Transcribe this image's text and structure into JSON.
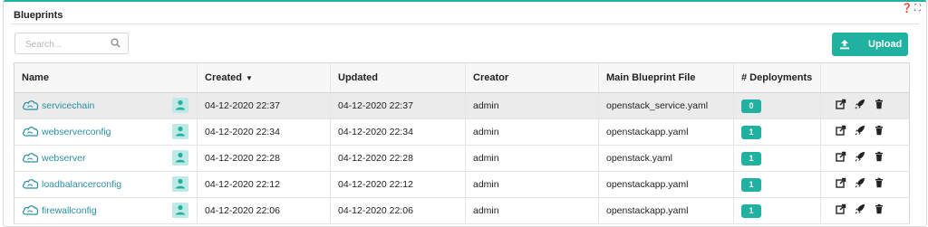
{
  "widget": {
    "title": "Blueprints",
    "help_icon": "help-icon",
    "expand_icon": "expand-icon"
  },
  "search": {
    "placeholder": "Search...",
    "icon": "search-icon"
  },
  "upload": {
    "label": "Upload",
    "icon": "upload-icon"
  },
  "table": {
    "columns": [
      "Name",
      "Created",
      "Updated",
      "Creator",
      "Main Blueprint File",
      "# Deployments",
      ""
    ],
    "sort_indicator": "▼",
    "rows": [
      {
        "name": "servicechain",
        "created": "04-12-2020 22:37",
        "updated": "04-12-2020 22:37",
        "creator": "admin",
        "file": "openstack_service.yaml",
        "deployments": "0",
        "selected": true
      },
      {
        "name": "webserverconfig",
        "created": "04-12-2020 22:34",
        "updated": "04-12-2020 22:34",
        "creator": "admin",
        "file": "openstackapp.yaml",
        "deployments": "1",
        "selected": false
      },
      {
        "name": "webserver",
        "created": "04-12-2020 22:28",
        "updated": "04-12-2020 22:28",
        "creator": "admin",
        "file": "openstack.yaml",
        "deployments": "1",
        "selected": false
      },
      {
        "name": "loadbalancerconfig",
        "created": "04-12-2020 22:12",
        "updated": "04-12-2020 22:12",
        "creator": "admin",
        "file": "openstackapp.yaml",
        "deployments": "1",
        "selected": false
      },
      {
        "name": "firewallconfig",
        "created": "04-12-2020 22:06",
        "updated": "04-12-2020 22:06",
        "creator": "admin",
        "file": "openstackapp.yaml",
        "deployments": "1",
        "selected": false
      }
    ]
  },
  "colors": {
    "accent": "#21b1a0",
    "link": "#2a8fa3",
    "selected_row": "#ebebeb",
    "user_chip": "#bfe9e4"
  }
}
